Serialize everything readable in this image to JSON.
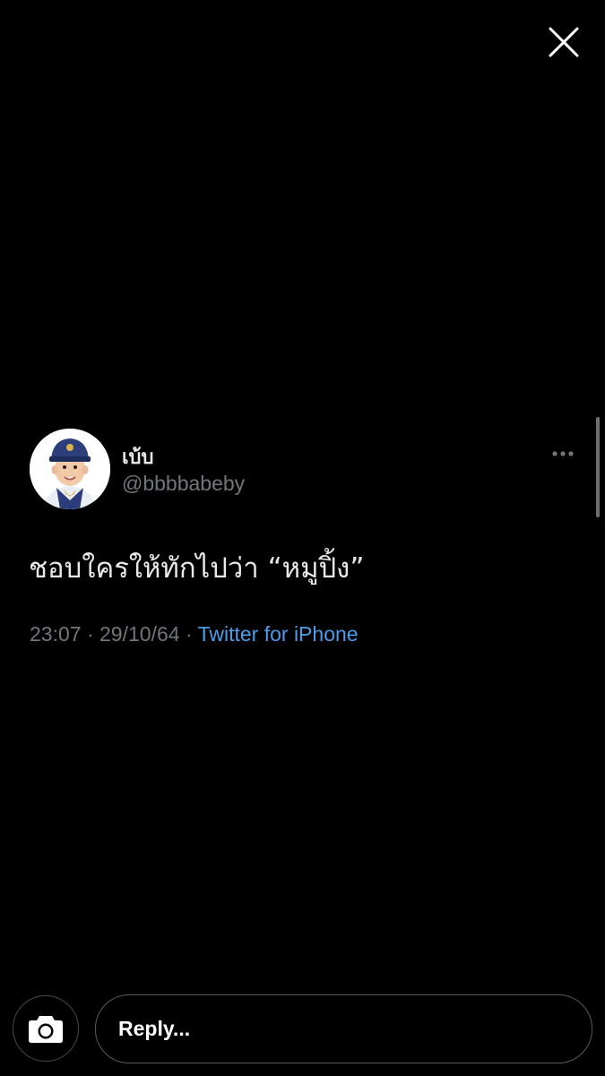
{
  "viewer": {
    "close_icon": "close-icon"
  },
  "tweet": {
    "display_name": "เบ้บ",
    "handle": "@bbbbabeby",
    "text": "ชอบใครให้ทักไปว่า “หมูปิ้ง”",
    "time": "23:07",
    "date": "29/10/64",
    "source": "Twitter for iPhone",
    "separator": "·",
    "more_icon": "more-dots-icon"
  },
  "reply": {
    "placeholder": "Reply...",
    "camera_icon": "camera-icon"
  },
  "colors": {
    "background": "#000000",
    "text": "#e7e9ea",
    "secondary_text": "#71767b",
    "link": "#4d9cea"
  }
}
